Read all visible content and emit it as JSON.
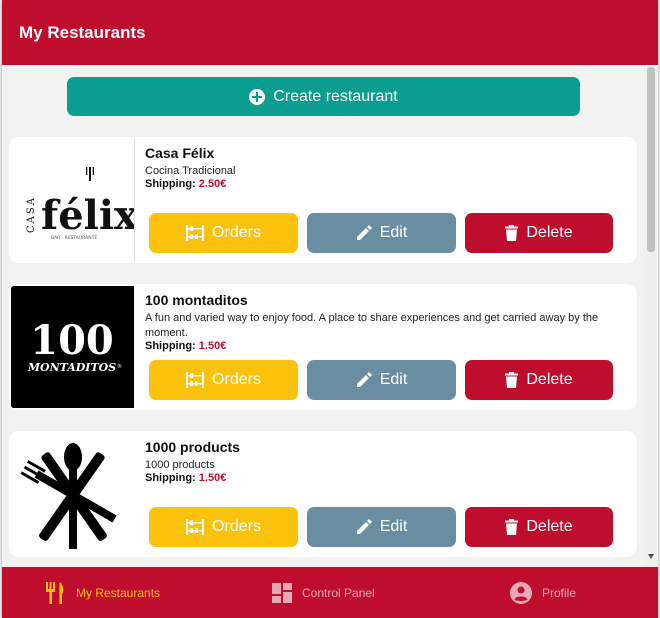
{
  "header": {
    "title": "My Restaurants"
  },
  "actions": {
    "create_label": "Create restaurant"
  },
  "restaurants": [
    {
      "name": "Casa Félix",
      "description": "Cocina Tradicional",
      "shipping_label": "Shipping:",
      "shipping_price": "2.50€",
      "logo": {
        "word_left": "CASA",
        "word_main": "félix",
        "tagline": "BAR · RESTAURANTE"
      }
    },
    {
      "name": "100 montaditos",
      "description": "A fun and varied way to enjoy food. A place to share experiences and get carried away by the moment.",
      "shipping_label": "Shipping:",
      "shipping_price": "1.50€",
      "logo": {
        "number": "100",
        "word": "MONTADITOS",
        "reg": "®"
      }
    },
    {
      "name": "1000 products",
      "description": "1000 products",
      "shipping_label": "Shipping:",
      "shipping_price": "1.50€",
      "logo": {
        "icon": "fork-knife-spoon-icon"
      }
    }
  ],
  "card_buttons": {
    "orders": "Orders",
    "edit": "Edit",
    "delete": "Delete"
  },
  "tabs": [
    {
      "label": "My Restaurants",
      "icon": "fork-knife-icon",
      "active": true
    },
    {
      "label": "Control Panel",
      "icon": "dashboard-icon",
      "active": false
    },
    {
      "label": "Profile",
      "icon": "account-circle-icon",
      "active": false
    }
  ],
  "colors": {
    "brand": "#bf0d2e",
    "primary_action": "#0a9d90",
    "orders": "#fbc20d",
    "edit": "#6a8ea1",
    "delete": "#bf0d2e",
    "tab_active": "#fbc20d"
  }
}
